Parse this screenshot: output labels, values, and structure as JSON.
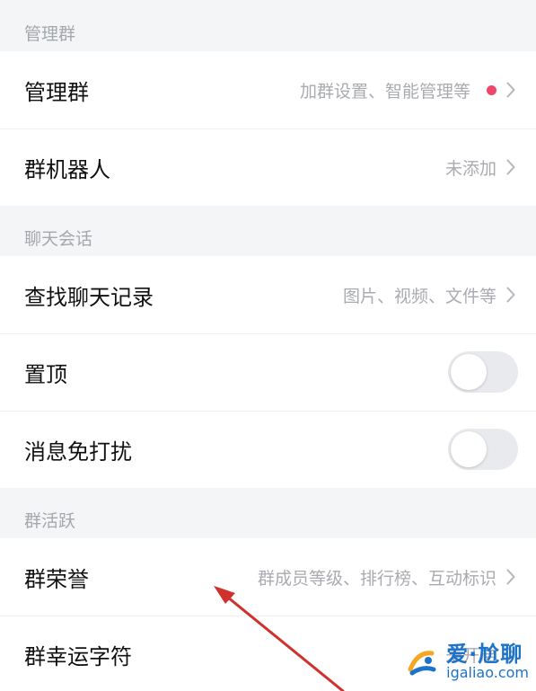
{
  "sections": {
    "manage": {
      "header": "管理群",
      "manage_group": {
        "label": "管理群",
        "detail": "加群设置、智能管理等"
      },
      "group_robot": {
        "label": "群机器人",
        "detail": "未添加"
      }
    },
    "chat": {
      "header": "聊天会话",
      "find_history": {
        "label": "查找聊天记录",
        "detail": "图片、视频、文件等"
      },
      "pin": {
        "label": "置顶",
        "toggle_on": false
      },
      "do_not_disturb": {
        "label": "消息免打扰",
        "toggle_on": false
      }
    },
    "activity": {
      "header": "群活跃",
      "group_honor": {
        "label": "群荣誉",
        "detail": "群成员等级、排行榜、互动标识"
      },
      "lucky_char": {
        "label": "群幸运字符",
        "detail": "未开启"
      }
    }
  },
  "watermark": {
    "title": "爱·尬聊",
    "domain": "igaliao.com"
  },
  "colors": {
    "background": "#f4f5f7",
    "card": "#ffffff",
    "badge_dot": "#ef4769",
    "secondary_text": "#a9abb0",
    "annotation_arrow": "#d0312d",
    "watermark_blue": "#1d73c9"
  }
}
